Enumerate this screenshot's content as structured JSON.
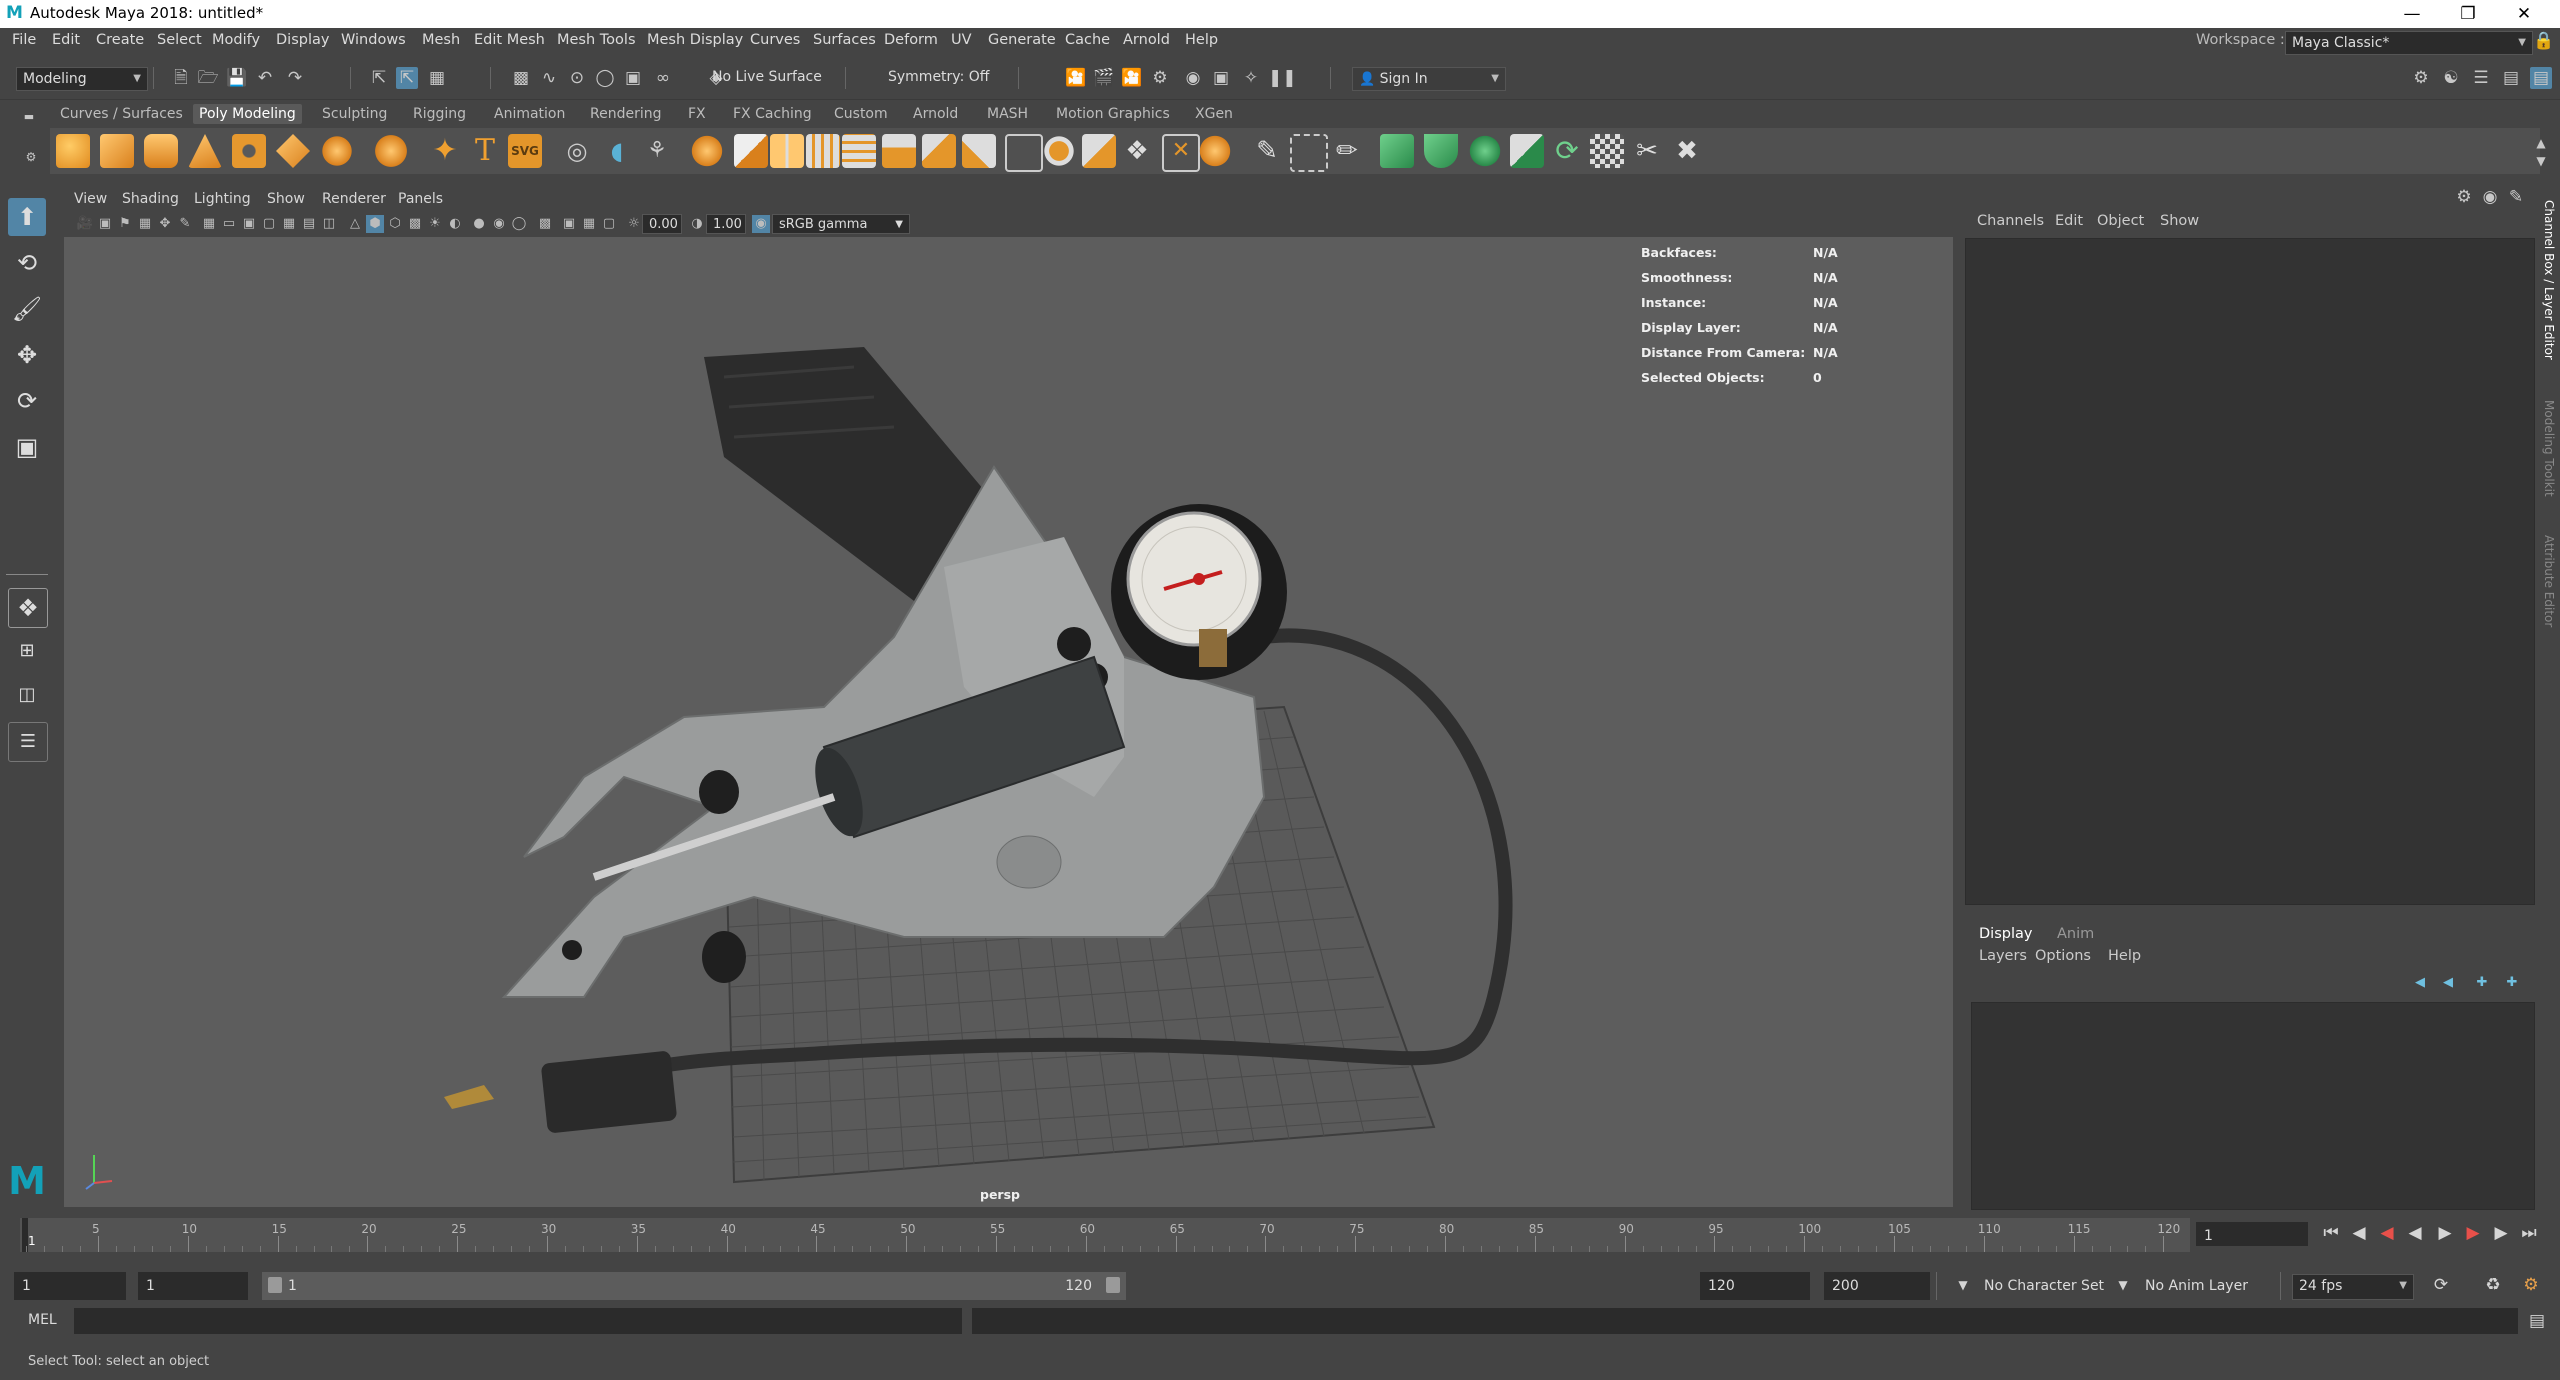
{
  "window": {
    "title": "Autodesk Maya 2018: untitled*",
    "logo_letter": "M"
  },
  "menubar": [
    "File",
    "Edit",
    "Create",
    "Select",
    "Modify",
    "Display",
    "Windows",
    "Mesh",
    "Edit Mesh",
    "Mesh Tools",
    "Mesh Display",
    "Curves",
    "Surfaces",
    "Deform",
    "UV",
    "Generate",
    "Cache",
    "Arnold",
    "Help"
  ],
  "workspace": {
    "label": "Workspace :",
    "value": "Maya Classic*"
  },
  "statusline": {
    "menuset": "Modeling",
    "live_surface": "No Live Surface",
    "symmetry": "Symmetry: Off",
    "sign_in": "Sign In"
  },
  "shelf_tabs": [
    "Curves / Surfaces",
    "Poly Modeling",
    "Sculpting",
    "Rigging",
    "Animation",
    "Rendering",
    "FX",
    "FX Caching",
    "Custom",
    "Arnold",
    "MASH",
    "Motion Graphics",
    "XGen"
  ],
  "shelf_active": "Poly Modeling",
  "panel_menu": [
    "View",
    "Shading",
    "Lighting",
    "Show",
    "Renderer",
    "Panels"
  ],
  "panel_toolbar": {
    "exposure": "0.00",
    "gamma": "1.00",
    "colorspace": "sRGB gamma"
  },
  "hud": [
    {
      "label": "Backfaces:",
      "value": "N/A"
    },
    {
      "label": "Smoothness:",
      "value": "N/A"
    },
    {
      "label": "Instance:",
      "value": "N/A"
    },
    {
      "label": "Display Layer:",
      "value": "N/A"
    },
    {
      "label": "Distance From Camera:",
      "value": "N/A"
    },
    {
      "label": "Selected Objects:",
      "value": "0"
    }
  ],
  "camera_label": "persp",
  "channelbox_menu": [
    "Channels",
    "Edit",
    "Object",
    "Show"
  ],
  "layer_tabs": [
    "Display",
    "Anim"
  ],
  "layer_tab_active": "Display",
  "layer_menu": [
    "Layers",
    "Options",
    "Help"
  ],
  "side_tabs": [
    "Channel Box / Layer Editor",
    "Modeling Toolkit",
    "Attribute Editor"
  ],
  "timeline": {
    "ticks": [
      "5",
      "10",
      "15",
      "20",
      "25",
      "30",
      "35",
      "40",
      "45",
      "50",
      "55",
      "60",
      "65",
      "70",
      "75",
      "80",
      "85",
      "90",
      "95",
      "100",
      "105",
      "110",
      "115",
      "120"
    ],
    "first": "1",
    "current_frame": "1"
  },
  "range": {
    "start": "1",
    "playback_start": "1",
    "slider_start": "1",
    "slider_end": "120",
    "playback_end": "120",
    "end": "200",
    "character_set": "No Character Set",
    "anim_layer": "No Anim Layer",
    "fps": "24 fps"
  },
  "cmdline": {
    "label": "MEL"
  },
  "helpline": "Select Tool: select an object",
  "colors": {
    "accent": "#13a1b8",
    "viewport_bg": "#5d5d5d",
    "panel": "#444444"
  }
}
